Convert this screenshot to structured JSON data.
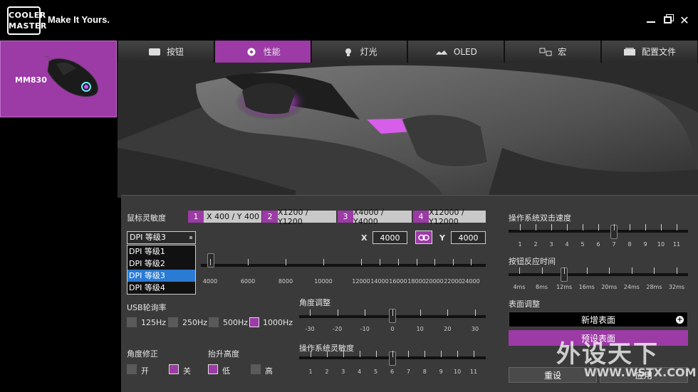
{
  "brand": {
    "logo_line1": "COOLER",
    "logo_line2": "MASTER",
    "tagline": "Make It Yours."
  },
  "device": {
    "name": "MM830"
  },
  "tabs": [
    {
      "label": "按钮",
      "icon": "keyboard-icon"
    },
    {
      "label": "性能",
      "icon": "performance-icon",
      "active": true
    },
    {
      "label": "灯光",
      "icon": "light-bulb-icon"
    },
    {
      "label": "OLED",
      "icon": "oled-icon"
    },
    {
      "label": "宏",
      "icon": "macro-icon"
    },
    {
      "label": "配置文件",
      "icon": "profile-icon"
    }
  ],
  "sensitivity": {
    "label": "鼠标灵敏度",
    "levels": [
      {
        "num": "1",
        "value": "X 400 / Y 400"
      },
      {
        "num": "2",
        "value": "X1200 / Y1200"
      },
      {
        "num": "3",
        "value": "X4000 / Y4000"
      },
      {
        "num": "4",
        "value": "X12000 / Y12000"
      }
    ],
    "x_label": "X",
    "x_value": "4000",
    "y_label": "Y",
    "y_value": "4000",
    "select_value": "DPI 等级3",
    "options": [
      "DPI 等级1",
      "DPI 等级2",
      "DPI 等级3",
      "DPI 等级4"
    ],
    "selected_index": 2,
    "ticks": [
      "4000",
      "6000",
      "8000",
      "10000",
      "12000",
      "14000",
      "16000",
      "18000",
      "20000",
      "22000",
      "24000"
    ]
  },
  "usb": {
    "label": "USB轮询率",
    "options": [
      {
        "label": "125Hz",
        "on": false
      },
      {
        "label": "250Hz",
        "on": false
      },
      {
        "label": "500Hz",
        "on": false
      },
      {
        "label": "1000Hz",
        "on": true
      }
    ]
  },
  "angle_snap": {
    "label": "角度修正",
    "on_label": "开",
    "off_label": "关"
  },
  "lift_off": {
    "label": "抬升高度",
    "low_label": "低",
    "high_label": "高"
  },
  "angle_adjust": {
    "label": "角度调整",
    "ticks": [
      "-30",
      "-20",
      "-10",
      "0",
      "10",
      "20",
      "30"
    ],
    "value": "0"
  },
  "os_sensitivity": {
    "label": "操作系统灵敏度",
    "ticks": [
      "1",
      "2",
      "3",
      "4",
      "5",
      "6",
      "7",
      "8",
      "9",
      "10",
      "11"
    ],
    "value": "6"
  },
  "double_click": {
    "label": "操作系统双击速度",
    "ticks": [
      "1",
      "2",
      "3",
      "4",
      "5",
      "6",
      "7",
      "8",
      "9",
      "10",
      "11"
    ],
    "value": "7"
  },
  "response": {
    "label": "按钮反应时间",
    "ticks": [
      "4ms",
      "8ms",
      "12ms",
      "16ms",
      "20ms",
      "24ms",
      "28ms",
      "32ms"
    ],
    "value": "12ms"
  },
  "surface": {
    "label": "表面调整",
    "new_label": "新增表面",
    "preset_label": "预设表面"
  },
  "actions": {
    "reset_label": "重设",
    "apply_label": "应用"
  },
  "watermark": {
    "line1": "外设天下",
    "line2": "WWW.WSTX.COM"
  },
  "colors": {
    "accent": "#9c3aa6",
    "panel": "#3a3a3a",
    "select": "#2a7bd4"
  }
}
